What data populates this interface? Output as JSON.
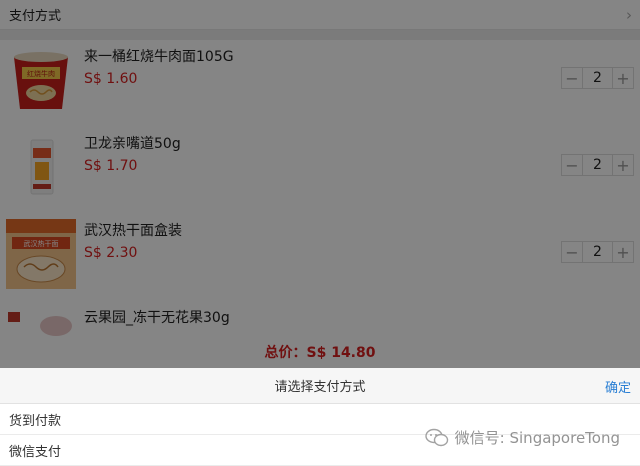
{
  "payment_row": {
    "label": "支付方式",
    "chevron": "›"
  },
  "cart": {
    "items": [
      {
        "name": "来一桶红烧牛肉面105G",
        "price": "S$ 1.60",
        "quantity": "2",
        "image": "instant-noodle-cup-image"
      },
      {
        "name": "卫龙亲嘴道50g",
        "price": "S$ 1.70",
        "quantity": "2",
        "image": "snack-pack-image"
      },
      {
        "name": "武汉热干面盒装",
        "price": "S$ 2.30",
        "quantity": "2",
        "image": "noodle-box-image"
      },
      {
        "name": "云果园_冻干无花果30g",
        "image": "dried-fig-pack-image"
      }
    ],
    "minus": "−",
    "plus": "+"
  },
  "total": "总价：S$ 14.80",
  "sheet": {
    "title": "请选择支付方式",
    "confirm": "确定",
    "options": [
      "货到付款",
      "微信支付"
    ]
  },
  "watermark": {
    "text": "微信号: SingaporeTong",
    "icon": "wechat-icon"
  }
}
